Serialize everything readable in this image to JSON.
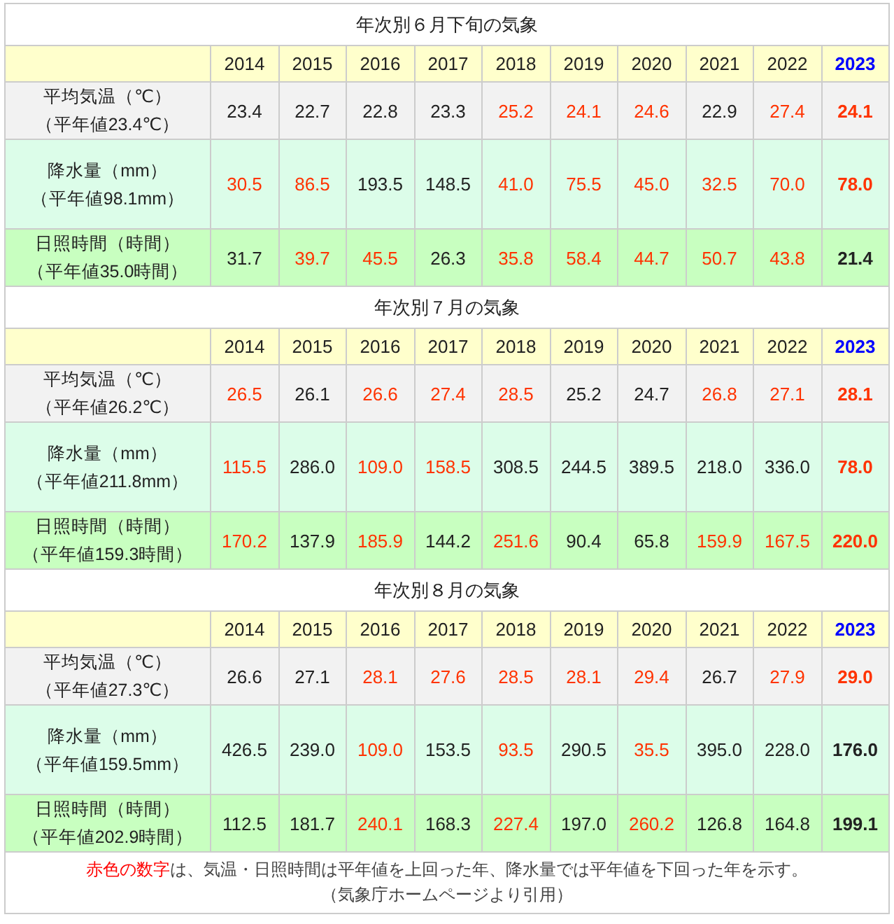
{
  "sections": [
    {
      "title": "年次別６月下旬の気象",
      "years": [
        {
          "label": "2014",
          "current": false
        },
        {
          "label": "2015",
          "current": false
        },
        {
          "label": "2016",
          "current": false
        },
        {
          "label": "2017",
          "current": false
        },
        {
          "label": "2018",
          "current": false
        },
        {
          "label": "2019",
          "current": false
        },
        {
          "label": "2020",
          "current": false
        },
        {
          "label": "2021",
          "current": false
        },
        {
          "label": "2022",
          "current": false
        },
        {
          "label": "2023",
          "current": true
        }
      ],
      "rows": [
        {
          "kind": "temp",
          "label": "平均気温（℃）",
          "normal": "（平年値23.4℃）",
          "cells": [
            {
              "text": "23.4",
              "highlighted": false
            },
            {
              "text": "22.7",
              "highlighted": false
            },
            {
              "text": "22.8",
              "highlighted": false
            },
            {
              "text": "23.3",
              "highlighted": false
            },
            {
              "text": "25.2",
              "highlighted": true
            },
            {
              "text": "24.1",
              "highlighted": true
            },
            {
              "text": "24.6",
              "highlighted": true
            },
            {
              "text": "22.9",
              "highlighted": false
            },
            {
              "text": "27.4",
              "highlighted": true
            },
            {
              "text": "24.1",
              "highlighted": true
            }
          ]
        },
        {
          "kind": "rain",
          "label": "降水量（mm）",
          "normal": "（平年値98.1mm）",
          "cells": [
            {
              "text": "30.5",
              "highlighted": true
            },
            {
              "text": "86.5",
              "highlighted": true
            },
            {
              "text": "193.5",
              "highlighted": false
            },
            {
              "text": "148.5",
              "highlighted": false
            },
            {
              "text": "41.0",
              "highlighted": true
            },
            {
              "text": "75.5",
              "highlighted": true
            },
            {
              "text": "45.0",
              "highlighted": true
            },
            {
              "text": "32.5",
              "highlighted": true
            },
            {
              "text": "70.0",
              "highlighted": true
            },
            {
              "text": "78.0",
              "highlighted": true
            }
          ]
        },
        {
          "kind": "sun",
          "label": "日照時間（時間）",
          "normal": "（平年値35.0時間）",
          "cells": [
            {
              "text": "31.7",
              "highlighted": false
            },
            {
              "text": "39.7",
              "highlighted": true
            },
            {
              "text": "45.5",
              "highlighted": true
            },
            {
              "text": "26.3",
              "highlighted": false
            },
            {
              "text": "35.8",
              "highlighted": true
            },
            {
              "text": "58.4",
              "highlighted": true
            },
            {
              "text": "44.7",
              "highlighted": true
            },
            {
              "text": "50.7",
              "highlighted": true
            },
            {
              "text": "43.8",
              "highlighted": true
            },
            {
              "text": "21.4",
              "highlighted": false
            }
          ]
        }
      ]
    },
    {
      "title": "年次別７月の気象",
      "years": [
        {
          "label": "2014",
          "current": false
        },
        {
          "label": "2015",
          "current": false
        },
        {
          "label": "2016",
          "current": false
        },
        {
          "label": "2017",
          "current": false
        },
        {
          "label": "2018",
          "current": false
        },
        {
          "label": "2019",
          "current": false
        },
        {
          "label": "2020",
          "current": false
        },
        {
          "label": "2021",
          "current": false
        },
        {
          "label": "2022",
          "current": false
        },
        {
          "label": "2023",
          "current": true
        }
      ],
      "rows": [
        {
          "kind": "temp",
          "label": "平均気温（℃）",
          "normal": "（平年値26.2℃）",
          "cells": [
            {
              "text": "26.5",
              "highlighted": true
            },
            {
              "text": "26.1",
              "highlighted": false
            },
            {
              "text": "26.6",
              "highlighted": true
            },
            {
              "text": "27.4",
              "highlighted": true
            },
            {
              "text": "28.5",
              "highlighted": true
            },
            {
              "text": "25.2",
              "highlighted": false
            },
            {
              "text": "24.7",
              "highlighted": false
            },
            {
              "text": "26.8",
              "highlighted": true
            },
            {
              "text": "27.1",
              "highlighted": true
            },
            {
              "text": "28.1",
              "highlighted": true
            }
          ]
        },
        {
          "kind": "rain",
          "label": "降水量（mm）",
          "normal": "（平年値211.8mm）",
          "cells": [
            {
              "text": "115.5",
              "highlighted": true
            },
            {
              "text": "286.0",
              "highlighted": false
            },
            {
              "text": "109.0",
              "highlighted": true
            },
            {
              "text": "158.5",
              "highlighted": true
            },
            {
              "text": "308.5",
              "highlighted": false
            },
            {
              "text": "244.5",
              "highlighted": false
            },
            {
              "text": "389.5",
              "highlighted": false
            },
            {
              "text": "218.0",
              "highlighted": false
            },
            {
              "text": "336.0",
              "highlighted": false
            },
            {
              "text": "78.0",
              "highlighted": true
            }
          ]
        },
        {
          "kind": "sun",
          "label": "日照時間（時間）",
          "normal": "（平年値159.3時間）",
          "cells": [
            {
              "text": "170.2",
              "highlighted": true
            },
            {
              "text": "137.9",
              "highlighted": false
            },
            {
              "text": "185.9",
              "highlighted": true
            },
            {
              "text": "144.2",
              "highlighted": false
            },
            {
              "text": "251.6",
              "highlighted": true
            },
            {
              "text": "90.4",
              "highlighted": false
            },
            {
              "text": "65.8",
              "highlighted": false
            },
            {
              "text": "159.9",
              "highlighted": true
            },
            {
              "text": "167.5",
              "highlighted": true
            },
            {
              "text": "220.0",
              "highlighted": true
            }
          ]
        }
      ]
    },
    {
      "title": "年次別８月の気象",
      "years": [
        {
          "label": "2014",
          "current": false
        },
        {
          "label": "2015",
          "current": false
        },
        {
          "label": "2016",
          "current": false
        },
        {
          "label": "2017",
          "current": false
        },
        {
          "label": "2018",
          "current": false
        },
        {
          "label": "2019",
          "current": false
        },
        {
          "label": "2020",
          "current": false
        },
        {
          "label": "2021",
          "current": false
        },
        {
          "label": "2022",
          "current": false
        },
        {
          "label": "2023",
          "current": true
        }
      ],
      "rows": [
        {
          "kind": "temp",
          "label": "平均気温（℃）",
          "normal": "（平年値27.3℃）",
          "cells": [
            {
              "text": "26.6",
              "highlighted": false
            },
            {
              "text": "27.1",
              "highlighted": false
            },
            {
              "text": "28.1",
              "highlighted": true
            },
            {
              "text": "27.6",
              "highlighted": true
            },
            {
              "text": "28.5",
              "highlighted": true
            },
            {
              "text": "28.1",
              "highlighted": true
            },
            {
              "text": "29.4",
              "highlighted": true
            },
            {
              "text": "26.7",
              "highlighted": false
            },
            {
              "text": "27.9",
              "highlighted": true
            },
            {
              "text": "29.0",
              "highlighted": true
            }
          ]
        },
        {
          "kind": "rain",
          "label": "降水量（mm）",
          "normal": "（平年値159.5mm）",
          "cells": [
            {
              "text": "426.5",
              "highlighted": false
            },
            {
              "text": "239.0",
              "highlighted": false
            },
            {
              "text": "109.0",
              "highlighted": true
            },
            {
              "text": "153.5",
              "highlighted": false
            },
            {
              "text": "93.5",
              "highlighted": true
            },
            {
              "text": "290.5",
              "highlighted": false
            },
            {
              "text": "35.5",
              "highlighted": true
            },
            {
              "text": "395.0",
              "highlighted": false
            },
            {
              "text": "228.0",
              "highlighted": false
            },
            {
              "text": "176.0",
              "highlighted": false
            }
          ]
        },
        {
          "kind": "sun",
          "label": "日照時間（時間）",
          "normal": "（平年値202.9時間）",
          "cells": [
            {
              "text": "112.5",
              "highlighted": false
            },
            {
              "text": "181.7",
              "highlighted": false
            },
            {
              "text": "240.1",
              "highlighted": true
            },
            {
              "text": "168.3",
              "highlighted": false
            },
            {
              "text": "227.4",
              "highlighted": true
            },
            {
              "text": "197.0",
              "highlighted": false
            },
            {
              "text": "260.2",
              "highlighted": true
            },
            {
              "text": "126.8",
              "highlighted": false
            },
            {
              "text": "164.8",
              "highlighted": false
            },
            {
              "text": "199.1",
              "highlighted": false
            }
          ]
        }
      ]
    }
  ],
  "note": {
    "highlight": "赤色の数字",
    "text": "は、気温・日照時間は平年値を上回った年、降水量では平年値を下回った年を示す。",
    "source": "（気象庁ホームページより引用）"
  }
}
